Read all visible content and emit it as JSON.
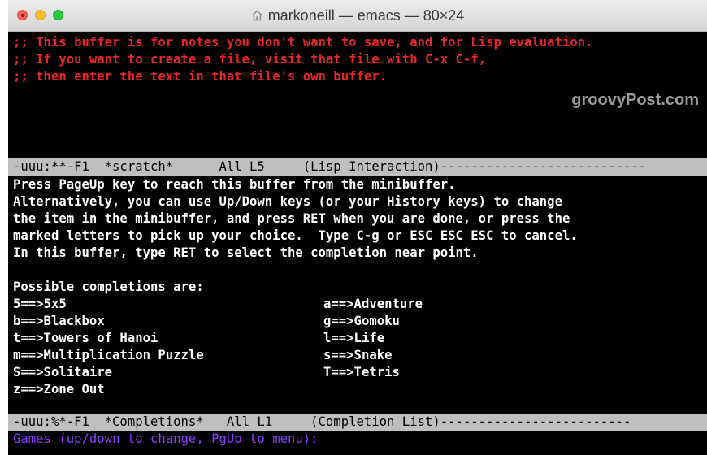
{
  "window": {
    "title": "markoneill — emacs — 80×24"
  },
  "scratch_buffer": {
    "comment_lines": [
      ";; This buffer is for notes you don't want to save, and for Lisp evaluation.",
      ";; If you want to create a file, visit that file with C-x C-f,",
      ";; then enter the text in that file's own buffer."
    ]
  },
  "watermark": "groovyPost.com",
  "modeline_scratch": "-uuu:**-F1  *scratch*      All L5     (Lisp Interaction)---------------------------",
  "completions_help": [
    "Press PageUp key to reach this buffer from the minibuffer.",
    "Alternatively, you can use Up/Down keys (or your History keys) to change",
    "the item in the minibuffer, and press RET when you are done, or press the",
    "marked letters to pick up your choice.  Type C-g or ESC ESC ESC to cancel.",
    "In this buffer, type RET to select the completion near point."
  ],
  "possible_heading": "Possible completions are:",
  "completions": {
    "left": [
      "5==>5x5",
      "b==>Blackbox",
      "t==>Towers of Hanoi",
      "m==>Multiplication Puzzle",
      "S==>Solitaire",
      "z==>Zone Out"
    ],
    "right": [
      "a==>Adventure",
      "g==>Gomoku",
      "l==>Life",
      "s==>Snake",
      "T==>Tetris"
    ]
  },
  "modeline_completions": "-uuu:%*-F1  *Completions*   All L1     (Completion List)-------------------------",
  "minibuffer_prompt": "Games (up/down to change, PgUp to menu):",
  "colors": {
    "comment": "#e8262a",
    "modeline_bg": "#bfbfbf",
    "prompt": "#8a3cff",
    "background": "#000000"
  }
}
